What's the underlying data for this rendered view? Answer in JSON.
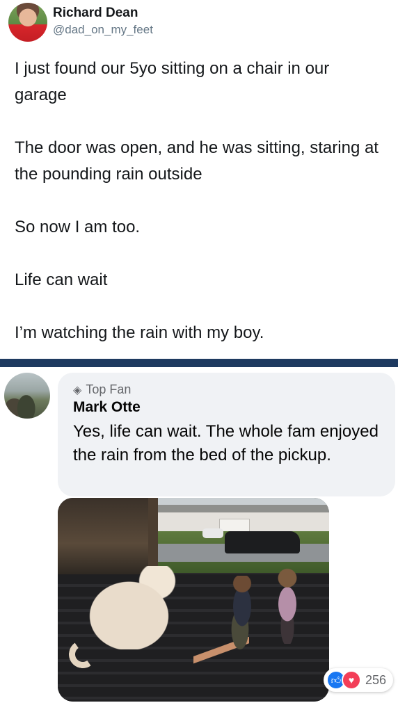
{
  "tweet": {
    "name": "Richard Dean",
    "handle": "@dad_on_my_feet",
    "paragraphs": [
      "I just found our 5yo sitting on a chair in our garage",
      "The door was open, and he was sitting, staring at the pounding rain outside",
      "So now I am too.",
      "Life can wait",
      "I’m watching the rain with my boy."
    ]
  },
  "comment": {
    "badge_icon": "gem-icon",
    "badge": "Top Fan",
    "name": "Mark Otte",
    "text": "Yes, life can wait. The whole fam enjoyed the rain from the bed of the pickup."
  },
  "reactions": {
    "icons": [
      "like-icon",
      "love-icon"
    ],
    "count": "256",
    "colors": {
      "like": "#1877f2",
      "love": "#f33e58"
    }
  },
  "colors": {
    "divider": "#1e3a60",
    "bubble": "#f0f2f5",
    "secondary_text": "#657786"
  }
}
